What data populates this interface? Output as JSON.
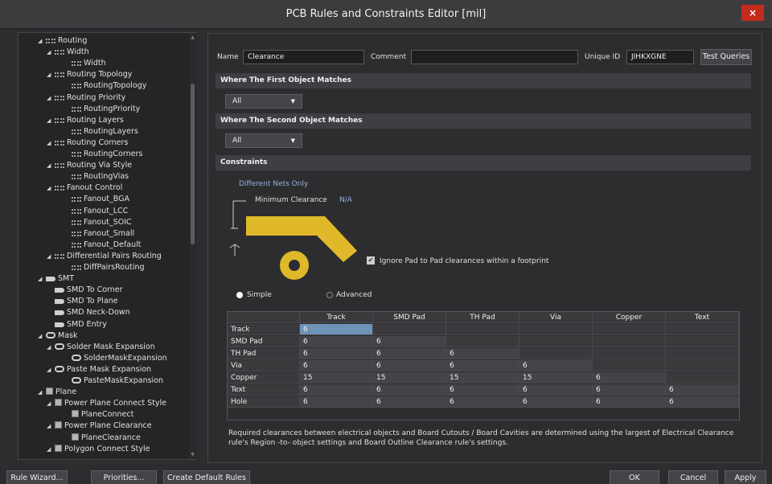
{
  "window": {
    "title": "PCB Rules and Constraints Editor [mil]",
    "close_glyph": "×"
  },
  "tree": {
    "nodes": [
      {
        "label": "Routing",
        "level": 1,
        "icon": "rule-icon",
        "expand": "◢"
      },
      {
        "label": "Width",
        "level": 2,
        "icon": "rule-icon",
        "expand": "◢"
      },
      {
        "label": "Width",
        "level": 3,
        "icon": "rule-icon",
        "expand": ""
      },
      {
        "label": "Routing Topology",
        "level": 2,
        "icon": "rule-icon",
        "expand": "◢"
      },
      {
        "label": "RoutingTopology",
        "level": 3,
        "icon": "rule-icon",
        "expand": ""
      },
      {
        "label": "Routing Priority",
        "level": 2,
        "icon": "rule-icon",
        "expand": "◢"
      },
      {
        "label": "RoutingPriority",
        "level": 3,
        "icon": "rule-icon",
        "expand": ""
      },
      {
        "label": "Routing Layers",
        "level": 2,
        "icon": "rule-icon",
        "expand": "◢"
      },
      {
        "label": "RoutingLayers",
        "level": 3,
        "icon": "rule-icon",
        "expand": ""
      },
      {
        "label": "Routing Corners",
        "level": 2,
        "icon": "rule-icon",
        "expand": "◢"
      },
      {
        "label": "RoutingCorners",
        "level": 3,
        "icon": "rule-icon",
        "expand": ""
      },
      {
        "label": "Routing Via Style",
        "level": 2,
        "icon": "rule-icon",
        "expand": "◢"
      },
      {
        "label": "RoutingVias",
        "level": 3,
        "icon": "rule-icon",
        "expand": ""
      },
      {
        "label": "Fanout Control",
        "level": 2,
        "icon": "rule-icon",
        "expand": "◢"
      },
      {
        "label": "Fanout_BGA",
        "level": 3,
        "icon": "rule-icon",
        "expand": ""
      },
      {
        "label": "Fanout_LCC",
        "level": 3,
        "icon": "rule-icon",
        "expand": ""
      },
      {
        "label": "Fanout_SOIC",
        "level": 3,
        "icon": "rule-icon",
        "expand": ""
      },
      {
        "label": "Fanout_Small",
        "level": 3,
        "icon": "rule-icon",
        "expand": ""
      },
      {
        "label": "Fanout_Default",
        "level": 3,
        "icon": "rule-icon",
        "expand": ""
      },
      {
        "label": "Differential Pairs Routing",
        "level": 2,
        "icon": "rule-icon",
        "expand": "◢"
      },
      {
        "label": "DiffPairsRouting",
        "level": 3,
        "icon": "rule-icon",
        "expand": ""
      },
      {
        "label": "SMT",
        "level": 1,
        "icon": "smt-icon",
        "expand": "◢"
      },
      {
        "label": "SMD To Corner",
        "level": 2,
        "icon": "smt-icon",
        "expand": ""
      },
      {
        "label": "SMD To Plane",
        "level": 2,
        "icon": "smt-icon",
        "expand": ""
      },
      {
        "label": "SMD Neck-Down",
        "level": 2,
        "icon": "smt-icon",
        "expand": ""
      },
      {
        "label": "SMD Entry",
        "level": 2,
        "icon": "smt-icon",
        "expand": ""
      },
      {
        "label": "Mask",
        "level": 1,
        "icon": "mask-icon",
        "expand": "◢"
      },
      {
        "label": "Solder Mask Expansion",
        "level": 2,
        "icon": "mask-icon",
        "expand": "◢"
      },
      {
        "label": "SolderMaskExpansion",
        "level": 3,
        "icon": "mask-icon",
        "expand": ""
      },
      {
        "label": "Paste Mask Expansion",
        "level": 2,
        "icon": "mask-icon",
        "expand": "◢"
      },
      {
        "label": "PasteMaskExpansion",
        "level": 3,
        "icon": "mask-icon",
        "expand": ""
      },
      {
        "label": "Plane",
        "level": 1,
        "icon": "plane-icon",
        "expand": "◢"
      },
      {
        "label": "Power Plane Connect Style",
        "level": 2,
        "icon": "plane-icon",
        "expand": "◢"
      },
      {
        "label": "PlaneConnect",
        "level": 3,
        "icon": "plane-icon",
        "expand": ""
      },
      {
        "label": "Power Plane Clearance",
        "level": 2,
        "icon": "plane-icon",
        "expand": "◢"
      },
      {
        "label": "PlaneClearance",
        "level": 3,
        "icon": "plane-icon",
        "expand": ""
      },
      {
        "label": "Polygon Connect Style",
        "level": 2,
        "icon": "plane-icon",
        "expand": "◢"
      }
    ]
  },
  "rule": {
    "name_label": "Name",
    "name_value": "Clearance",
    "comment_label": "Comment",
    "comment_value": "",
    "uid_label": "Unique ID",
    "uid_value": "JIHKXGNE",
    "test_queries": "Test Queries"
  },
  "first_match": {
    "header": "Where The First Object Matches",
    "selected": "All"
  },
  "second_match": {
    "header": "Where The Second Object Matches",
    "selected": "All"
  },
  "constraints": {
    "header": "Constraints",
    "different_nets": "Different Nets Only",
    "min_clearance_label": "Minimum Clearance",
    "min_clearance_value": "N/A",
    "ignore_pad_label": "Ignore Pad to Pad clearances within a footprint",
    "ignore_pad_checked": true,
    "mode_simple": "Simple",
    "mode_advanced": "Advanced",
    "mode_selected": "Simple",
    "colors": {
      "trace": "#e0b92a",
      "link": "#8fb4e0"
    }
  },
  "grid": {
    "columns": [
      "Track",
      "SMD Pad",
      "TH Pad",
      "Via",
      "Copper",
      "Text"
    ],
    "rows": [
      {
        "label": "Track",
        "values": [
          "6",
          "",
          "",
          "",
          "",
          ""
        ]
      },
      {
        "label": "SMD Pad",
        "values": [
          "6",
          "6",
          "",
          "",
          "",
          ""
        ]
      },
      {
        "label": "TH Pad",
        "values": [
          "6",
          "6",
          "6",
          "",
          "",
          ""
        ]
      },
      {
        "label": "Via",
        "values": [
          "6",
          "6",
          "6",
          "6",
          "",
          ""
        ]
      },
      {
        "label": "Copper",
        "values": [
          "15",
          "15",
          "15",
          "15",
          "6",
          ""
        ]
      },
      {
        "label": "Text",
        "values": [
          "6",
          "6",
          "6",
          "6",
          "6",
          "6"
        ]
      },
      {
        "label": "Hole",
        "values": [
          "6",
          "6",
          "6",
          "6",
          "6",
          "6"
        ]
      }
    ]
  },
  "note": "Required clearances between electrical objects and Board Cutouts / Board Cavities are determined using the largest of Electrical Clearance rule's Region -to- object settings and Board Outline Clearance rule's settings.",
  "footer": {
    "rule_wizard": "Rule Wizard...",
    "priorities": "Priorities...",
    "create_defaults": "Create Default Rules",
    "ok": "OK",
    "cancel": "Cancel",
    "apply": "Apply"
  }
}
